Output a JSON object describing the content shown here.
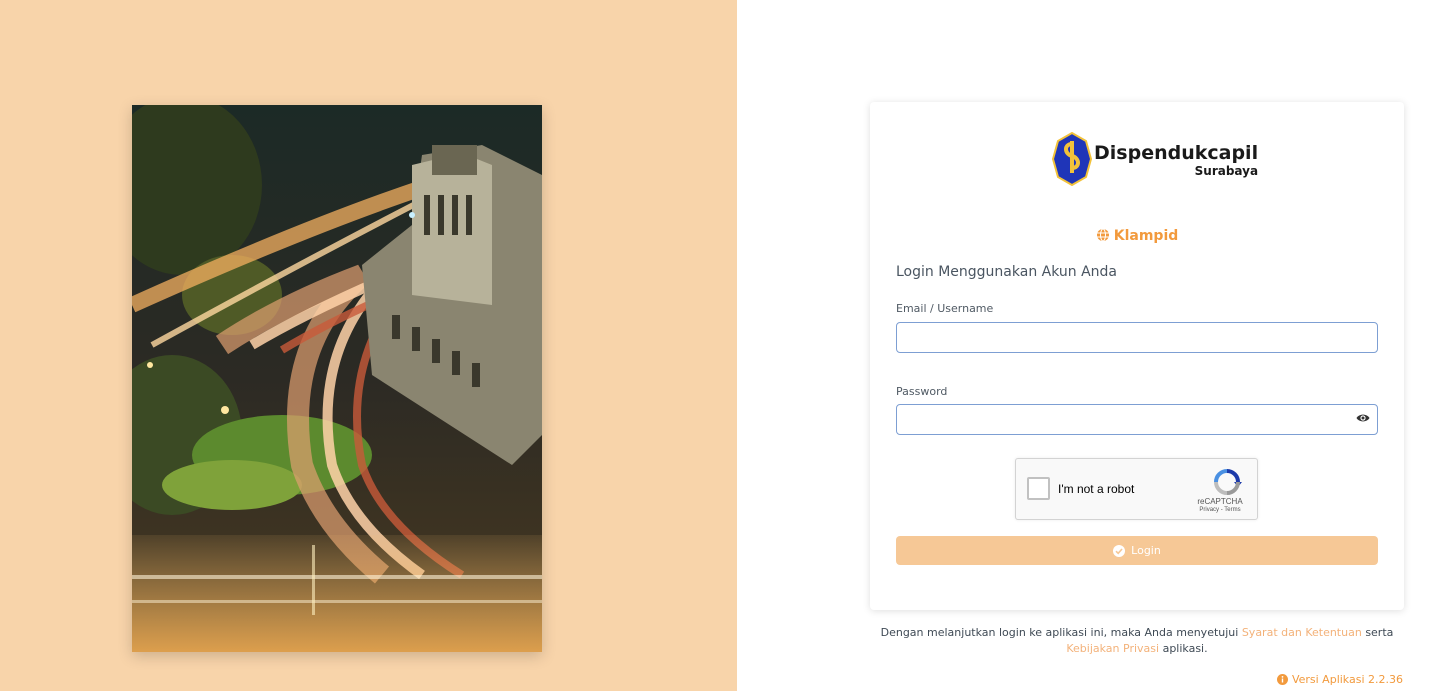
{
  "brand": {
    "logo_line1": "Dispendukcapil",
    "logo_line2": "Surabaya",
    "site_name": "Klampid",
    "colors": {
      "accent": "#f29a3d",
      "left_panel": "#f8d4aa",
      "button": "#f6c896",
      "input_border": "#7d9fd3"
    }
  },
  "form": {
    "heading": "Login Menggunakan Akun Anda",
    "email_label": "Email / Username",
    "email_value": "",
    "password_label": "Password",
    "password_value": "",
    "login_label": "Login"
  },
  "recaptcha": {
    "checkbox_label": "I'm not a robot",
    "brand": "reCAPTCHA",
    "privacy": "Privacy",
    "separator": "-",
    "terms": "Terms"
  },
  "footer": {
    "terms_prefix": "Dengan melanjutkan login ke aplikasi ini, maka Anda menyetujui",
    "terms_link": "Syarat dan Ketentuan",
    "terms_middle": "serta",
    "privacy_link": "Kebijakan Privasi",
    "terms_suffix": "aplikasi.",
    "version": "Versi Aplikasi 2.2.36"
  },
  "icons": {
    "globe": "globe-icon",
    "eye": "eye-icon",
    "check": "check-circle-icon",
    "info": "info-circle-icon"
  }
}
